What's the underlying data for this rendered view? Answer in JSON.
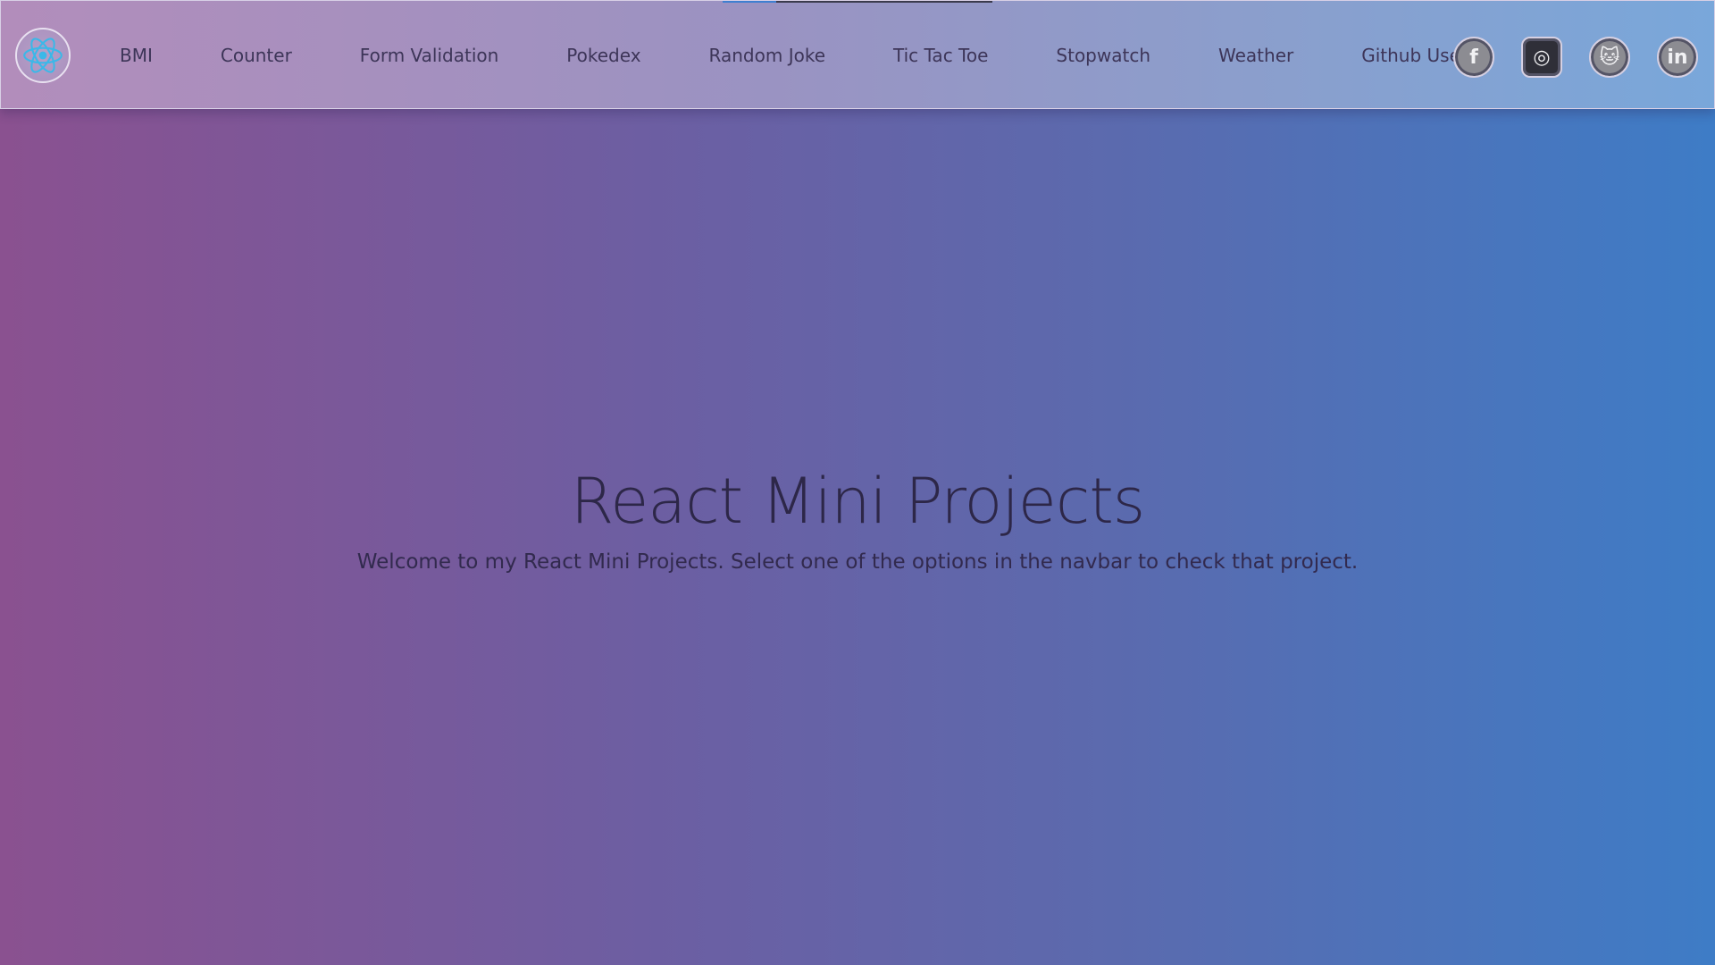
{
  "topbar": {
    "progress": 0.2,
    "logo_icon": "react-atom-icon",
    "nav": [
      {
        "label": "BMI"
      },
      {
        "label": "Counter"
      },
      {
        "label": "Form Validation"
      },
      {
        "label": "Pokedex"
      },
      {
        "label": "Random Joke"
      },
      {
        "label": "Tic Tac Toe"
      },
      {
        "label": "Stopwatch"
      },
      {
        "label": "Weather"
      },
      {
        "label": "Github Users"
      }
    ],
    "socials": [
      {
        "icon": "facebook-icon",
        "glyph": "f"
      },
      {
        "icon": "instagram-icon",
        "glyph": "◎"
      },
      {
        "icon": "github-icon",
        "glyph": "🐱"
      },
      {
        "icon": "linkedin-icon",
        "glyph": "in"
      }
    ]
  },
  "hero": {
    "title": "React Mini Projects",
    "subtitle": "Welcome to my React Mini Projects. Select one of the options in the navbar to check that project."
  },
  "colors": {
    "accent": "#3f7fd0",
    "react_blue": "#3bb8e8"
  }
}
